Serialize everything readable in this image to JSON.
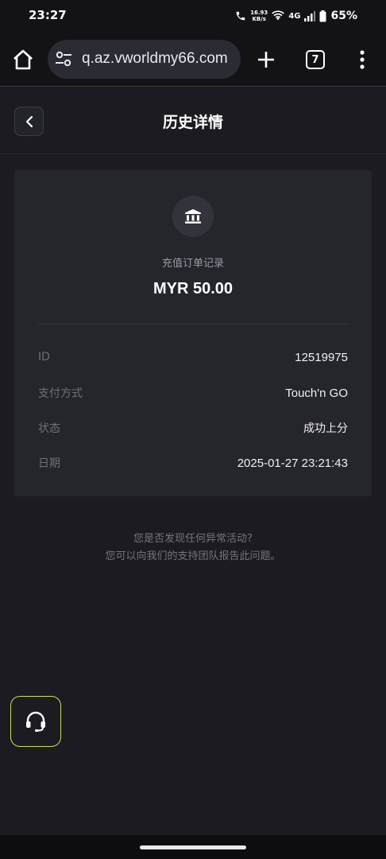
{
  "status_bar": {
    "time": "23:27",
    "speed_value": "16.93",
    "speed_unit": "KB/s",
    "network": "4G",
    "battery": "65%"
  },
  "browser": {
    "url": "q.az.vworldmy66.com",
    "tab_count": "7"
  },
  "header": {
    "title": "历史详情"
  },
  "detail": {
    "order_type": "充值订单记录",
    "amount": "MYR 50.00",
    "rows": [
      {
        "label": "ID",
        "value": "12519975"
      },
      {
        "label": "支付方式",
        "value": "Touch'n GO"
      },
      {
        "label": "状态",
        "value": "成功上分"
      },
      {
        "label": "日期",
        "value": "2025-01-27 23:21:43"
      }
    ]
  },
  "help": {
    "line1": "您是否发现任何异常活动?",
    "line2": "您可以向我们的支持团队报告此问题。"
  },
  "icons": {
    "home": "home-icon",
    "site_settings": "tune-icon",
    "new_tab": "plus-icon",
    "menu": "more-vert-icon",
    "back": "chevron-left-icon",
    "bank": "bank-icon",
    "support": "headset-icon"
  },
  "colors": {
    "background": "#1b1b21",
    "card": "#25252c",
    "support_border": "#c8e35a"
  }
}
